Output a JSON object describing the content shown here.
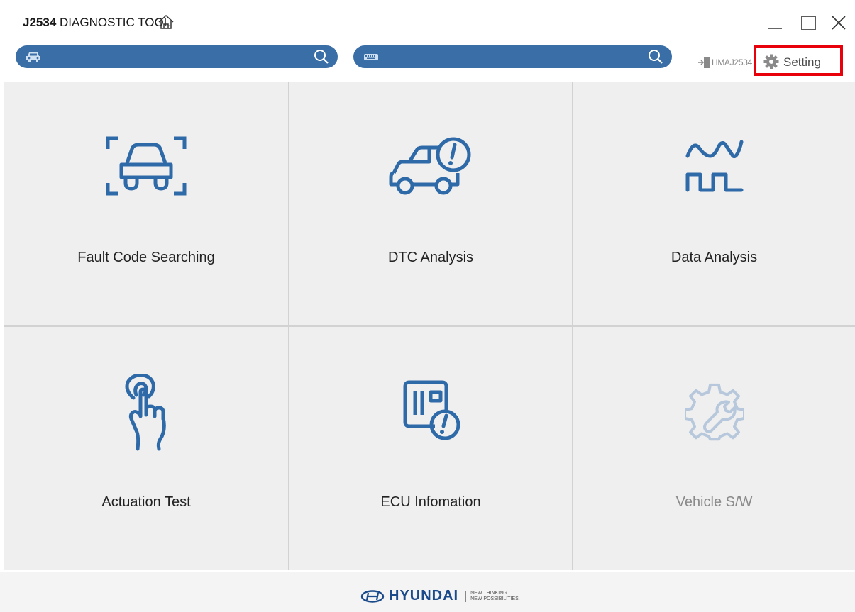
{
  "window": {
    "title_bold": "J2534",
    "title_rest": "DIAGNOSTIC TOOL"
  },
  "toolbar": {
    "vehicle_search": {
      "value": "",
      "placeholder": ""
    },
    "dtc_search": {
      "value": "",
      "placeholder": ""
    },
    "connection_label": "HMAJ2534",
    "setting_label": "Setting"
  },
  "tiles": [
    {
      "label": "Fault Code Searching",
      "icon": "car-scan-icon",
      "enabled": true
    },
    {
      "label": "DTC Analysis",
      "icon": "car-warning-icon",
      "enabled": true
    },
    {
      "label": "Data Analysis",
      "icon": "waveform-icon",
      "enabled": true
    },
    {
      "label": "Actuation Test",
      "icon": "touch-finger-icon",
      "enabled": true
    },
    {
      "label": "ECU Infomation",
      "icon": "ecu-info-icon",
      "enabled": true
    },
    {
      "label": "Vehicle S/W",
      "icon": "gear-wrench-icon",
      "enabled": false
    }
  ],
  "footer": {
    "brand": "HYUNDAI",
    "tagline_1": "NEW THINKING.",
    "tagline_2": "NEW POSSIBILITIES."
  },
  "colors": {
    "accent": "#3a6ea6",
    "icon": "#2f6aa8",
    "highlight": "#e8000b",
    "tile": "#efefef",
    "disabled_icon": "#b7c8dc"
  }
}
